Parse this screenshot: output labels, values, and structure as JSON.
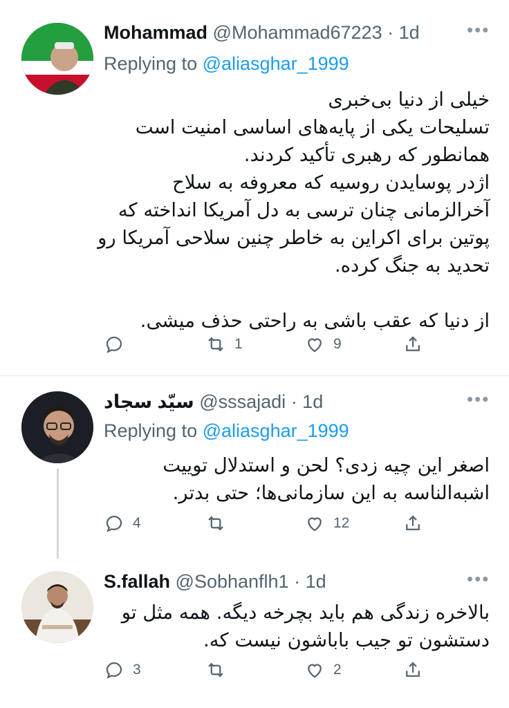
{
  "tweets": [
    {
      "name": "Mohammad",
      "handle": "@Mohammad67223",
      "time": "· 1d",
      "replying_prefix": "Replying to",
      "replying_to": "@aliasghar_1999",
      "text": "خیلی از دنیا بی‌خبری\nتسلیحات یکی از پایه‌های اساسی امنیت است\nهمانطور که رهبری تأکید کردند.\nاژدر پوسایدن روسیه که معروفه به سلاح\nآخرالزمانی چنان ترسی به دل آمریکا انداخته که\nپوتین برای اکراین به خاطر چنین سلاحی آمریکا رو\nتحدید به جنگ کرده.\n\nاز دنیا که عقب باشی به راحتی حذف میشی.",
      "replies": "",
      "retweets": "1",
      "likes": "9"
    },
    {
      "name": "سیّد سجاد",
      "handle": "@sssajadi",
      "time": "· 1d",
      "replying_prefix": "Replying to",
      "replying_to": "@aliasghar_1999",
      "text": "اصغر این چیه زدی؟ لحن و استدلال توییت\nاشبه‌الناسه به این سازمانی‌ها؛ حتی بدتر.",
      "replies": "4",
      "retweets": "",
      "likes": "12"
    },
    {
      "name": "S.fallah",
      "handle": "@Sobhanflh1",
      "time": "· 1d",
      "text": "بالاخره زندگی هم باید بچرخه دیگه. همه مثل تو\nدستشون تو جیب باباشون نیست که.",
      "replies": "3",
      "retweets": "",
      "likes": "2"
    }
  ],
  "colors": {
    "accent": "#1d9bf0",
    "muted": "#536471",
    "text": "#0f1419"
  },
  "icons": [
    "more-icon",
    "reply-icon",
    "retweet-icon",
    "like-icon",
    "share-icon"
  ]
}
